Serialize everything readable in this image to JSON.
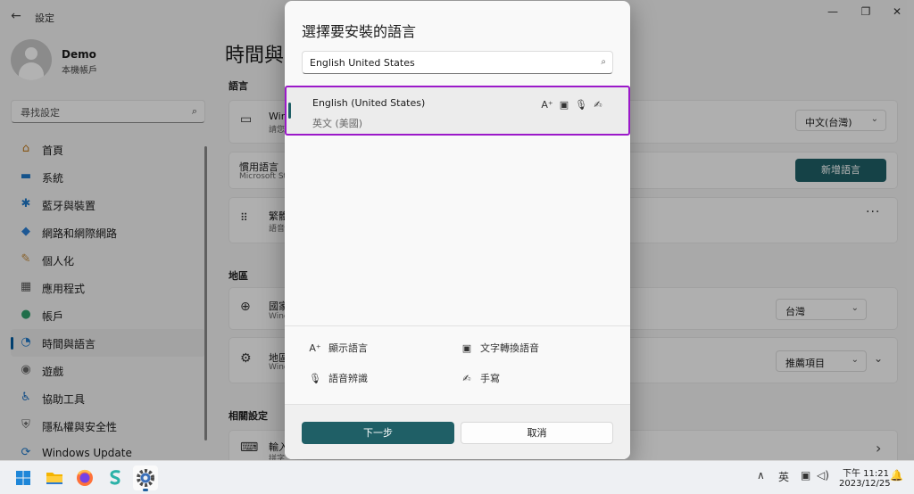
{
  "window": {
    "title": "設定",
    "back_glyph": "←",
    "minimize_glyph": "—",
    "maximize_glyph": "❐",
    "close_glyph": "✕"
  },
  "profile": {
    "name": "Demo",
    "subtitle": "本機帳戶"
  },
  "sidebar": {
    "search_placeholder": "尋找設定",
    "search_icon": "⌕",
    "items": [
      {
        "label": "首頁",
        "icon": "home-icon",
        "glyph": "⌂",
        "color": "#c07a1e"
      },
      {
        "label": "系統",
        "icon": "monitor-icon",
        "glyph": "▬",
        "color": "#1e78c8"
      },
      {
        "label": "藍牙與裝置",
        "icon": "bluetooth-icon",
        "glyph": "✱",
        "color": "#1e78c8"
      },
      {
        "label": "網路和網際網路",
        "icon": "wifi-icon",
        "glyph": "◆",
        "color": "#2a7fd4"
      },
      {
        "label": "個人化",
        "icon": "brush-icon",
        "glyph": "✎",
        "color": "#c28a3a"
      },
      {
        "label": "應用程式",
        "icon": "apps-icon",
        "glyph": "▦",
        "color": "#555555"
      },
      {
        "label": "帳戶",
        "icon": "account-icon",
        "glyph": "●",
        "color": "#2f9e6a"
      },
      {
        "label": "時間與語言",
        "icon": "globe-clock-icon",
        "glyph": "◔",
        "color": "#1e78c8",
        "active": true
      },
      {
        "label": "遊戲",
        "icon": "gamepad-icon",
        "glyph": "◉",
        "color": "#666666"
      },
      {
        "label": "協助工具",
        "icon": "accessibility-icon",
        "glyph": "♿",
        "color": "#1e6fbf"
      },
      {
        "label": "隱私權與安全性",
        "icon": "shield-icon",
        "glyph": "⛨",
        "color": "#666666"
      },
      {
        "label": "Windows Update",
        "icon": "update-icon",
        "glyph": "⟳",
        "color": "#1e78c8"
      }
    ]
  },
  "main": {
    "title": "時間與",
    "sections": {
      "language": "語言",
      "region": "地區",
      "related": "相關設定"
    },
    "cards": {
      "display_lang": {
        "title": "Win",
        "sub": "請您",
        "dropdown": "中文(台灣)"
      },
      "preferred": {
        "title": "慣用語言",
        "sub": "Microsoft St",
        "button": "新增語言"
      },
      "installed": {
        "title": "繁體",
        "sub": "語音",
        "more": "···"
      },
      "country": {
        "title": "國家",
        "sub": "Wind",
        "dropdown": "台灣"
      },
      "format": {
        "title": "地區",
        "sub": "Wind",
        "dropdown": "推薦項目"
      },
      "typing": {
        "title": "輸入",
        "sub": "拼字"
      }
    },
    "chevron": "›",
    "dropdown_arrow": "⌄"
  },
  "dialog": {
    "title": "選擇要安裝的語言",
    "search_value": "English United States",
    "search_icon": "⌕",
    "result": {
      "name": "English (United States)",
      "native": "英文 (美國)",
      "features": [
        {
          "icon": "display-language-icon",
          "glyph": "A⁺"
        },
        {
          "icon": "text-to-speech-icon",
          "glyph": "▣"
        },
        {
          "icon": "microphone-icon",
          "glyph": "🎙"
        },
        {
          "icon": "handwriting-icon",
          "glyph": "✍"
        }
      ]
    },
    "legend": [
      {
        "label": "顯示語言",
        "icon": "display-language-icon",
        "glyph": "A⁺"
      },
      {
        "label": "文字轉換語音",
        "icon": "text-to-speech-icon",
        "glyph": "▣"
      },
      {
        "label": "語音辨識",
        "icon": "microphone-icon",
        "glyph": "🎙"
      },
      {
        "label": "手寫",
        "icon": "handwriting-icon",
        "glyph": "✍"
      }
    ],
    "next_button": "下一步",
    "cancel_button": "取消"
  },
  "taskbar": {
    "apps": [
      {
        "name": "start-icon"
      },
      {
        "name": "file-explorer-icon"
      },
      {
        "name": "firefox-icon"
      },
      {
        "name": "app-s-icon"
      },
      {
        "name": "settings-gear-icon",
        "active": true
      }
    ],
    "tray_chevron": "∧",
    "ime": "英",
    "time": "下午 11:21",
    "date": "2023/12/25",
    "bell_glyph": "🔔"
  }
}
